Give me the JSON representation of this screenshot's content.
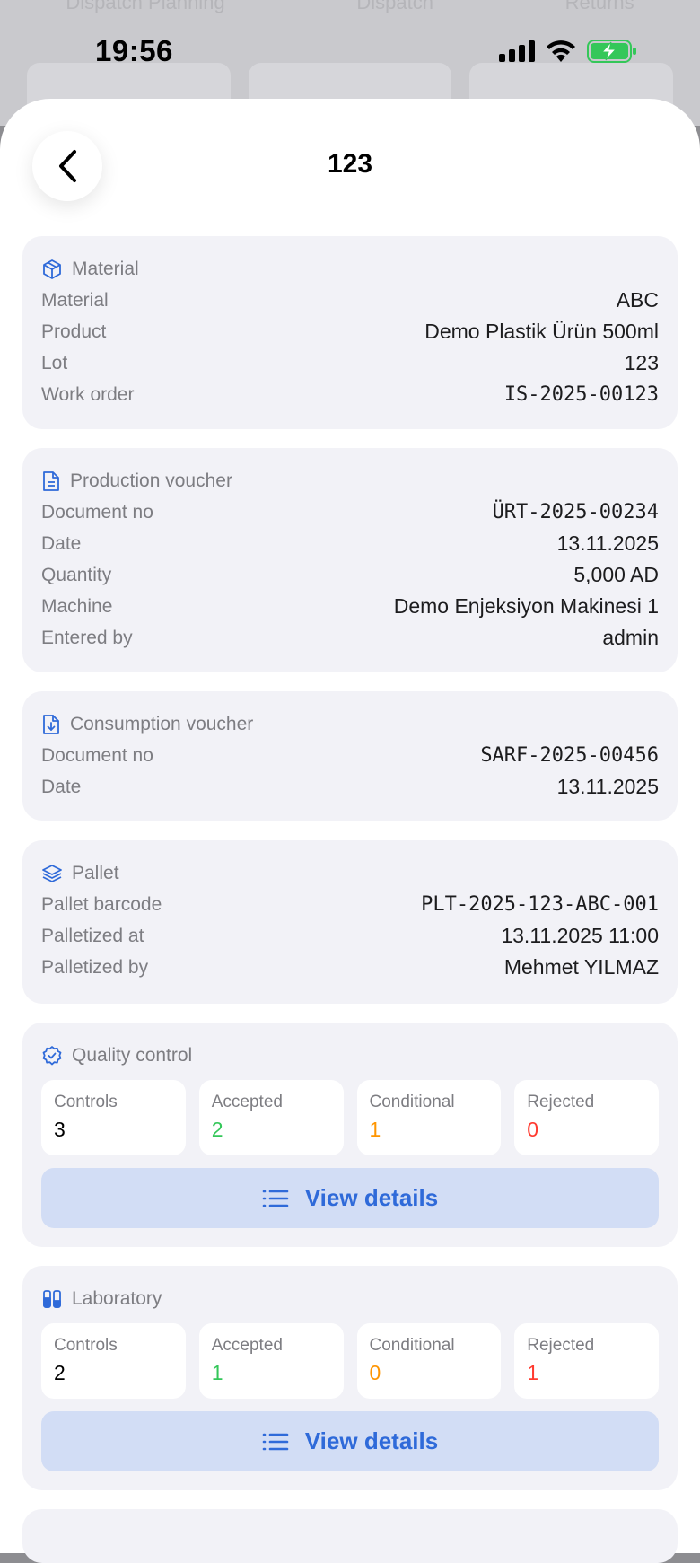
{
  "background": {
    "tabs": [
      "Dispatch Planning",
      "Dispatch",
      "Returns"
    ]
  },
  "status_bar": {
    "time": "19:56"
  },
  "header": {
    "title": "123"
  },
  "material": {
    "heading": "Material",
    "rows": [
      {
        "label": "Material",
        "value": "ABC"
      },
      {
        "label": "Product",
        "value": "Demo Plastik Ürün 500ml"
      },
      {
        "label": "Lot",
        "value": "123"
      },
      {
        "label": "Work order",
        "value": "IS-2025-00123"
      }
    ]
  },
  "production": {
    "heading": "Production voucher",
    "rows": [
      {
        "label": "Document no",
        "value": "ÜRT-2025-00234"
      },
      {
        "label": "Date",
        "value": "13.11.2025"
      },
      {
        "label": "Quantity",
        "value": "5,000 AD"
      },
      {
        "label": "Machine",
        "value": "Demo Enjeksiyon Makinesi 1"
      },
      {
        "label": "Entered by",
        "value": "admin"
      }
    ]
  },
  "consumption": {
    "heading": "Consumption voucher",
    "rows": [
      {
        "label": "Document no",
        "value": "SARF-2025-00456"
      },
      {
        "label": "Date",
        "value": "13.11.2025"
      }
    ]
  },
  "pallet": {
    "heading": "Pallet",
    "rows": [
      {
        "label": "Pallet barcode",
        "value": "PLT-2025-123-ABC-001"
      },
      {
        "label": "Palletized at",
        "value": "13.11.2025 11:00"
      },
      {
        "label": "Palletized by",
        "value": "Mehmet YILMAZ"
      }
    ]
  },
  "quality": {
    "heading": "Quality control",
    "stats": [
      {
        "label": "Controls",
        "value": "3"
      },
      {
        "label": "Accepted",
        "value": "2"
      },
      {
        "label": "Conditional",
        "value": "1"
      },
      {
        "label": "Rejected",
        "value": "0"
      }
    ],
    "button": "View details"
  },
  "laboratory": {
    "heading": "Laboratory",
    "stats": [
      {
        "label": "Controls",
        "value": "2"
      },
      {
        "label": "Accepted",
        "value": "1"
      },
      {
        "label": "Conditional",
        "value": "0"
      },
      {
        "label": "Rejected",
        "value": "1"
      }
    ],
    "button": "View details"
  },
  "colors": {
    "accent": "#2f6ad9",
    "accepted": "#34c759",
    "conditional": "#ff9500",
    "rejected": "#ff3b30",
    "card_bg": "#f2f2f7",
    "button_bg": "#d2ddf5"
  }
}
